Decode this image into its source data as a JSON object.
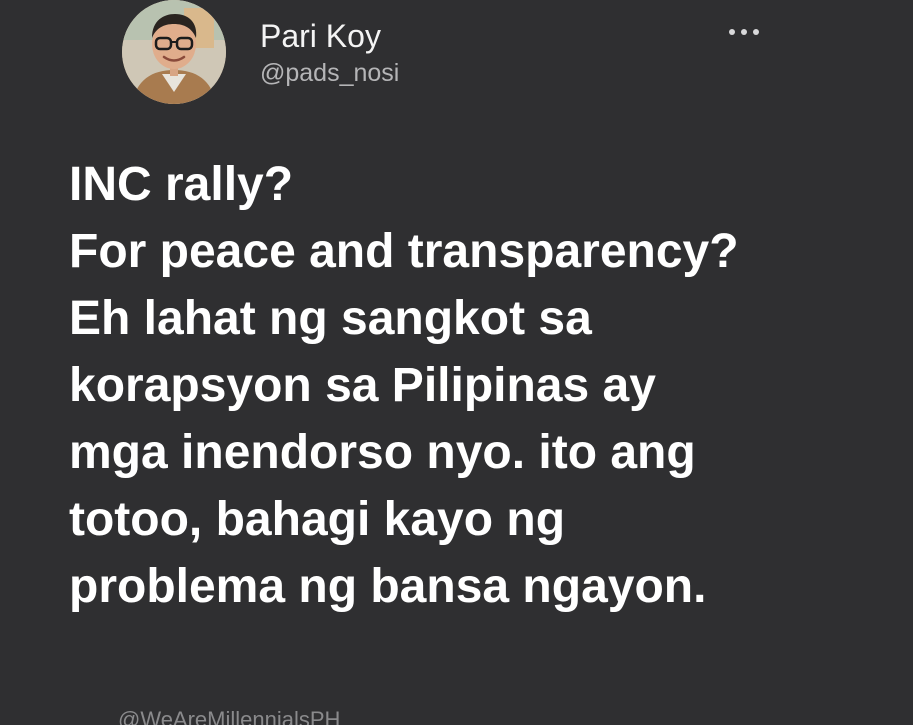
{
  "author": {
    "display_name": "Pari Koy",
    "handle": "@pads_nosi",
    "avatar_icon": "person-with-glasses-avatar"
  },
  "more_menu": {
    "icon": "more-horizontal-icon"
  },
  "tweet": {
    "lines": [
      "INC rally?",
      "For peace and transparency?",
      "Eh lahat ng sangkot sa",
      "korapsyon sa Pilipinas ay",
      "mga inendorso nyo. ito ang",
      "totoo, bahagi kayo ng",
      "problema ng bansa ngayon."
    ]
  },
  "watermark": {
    "text": "@WeAreMillennialsPH"
  },
  "colors": {
    "background": "#2f2f31",
    "text": "#ffffff",
    "secondary_text": "#b5b5b7"
  }
}
